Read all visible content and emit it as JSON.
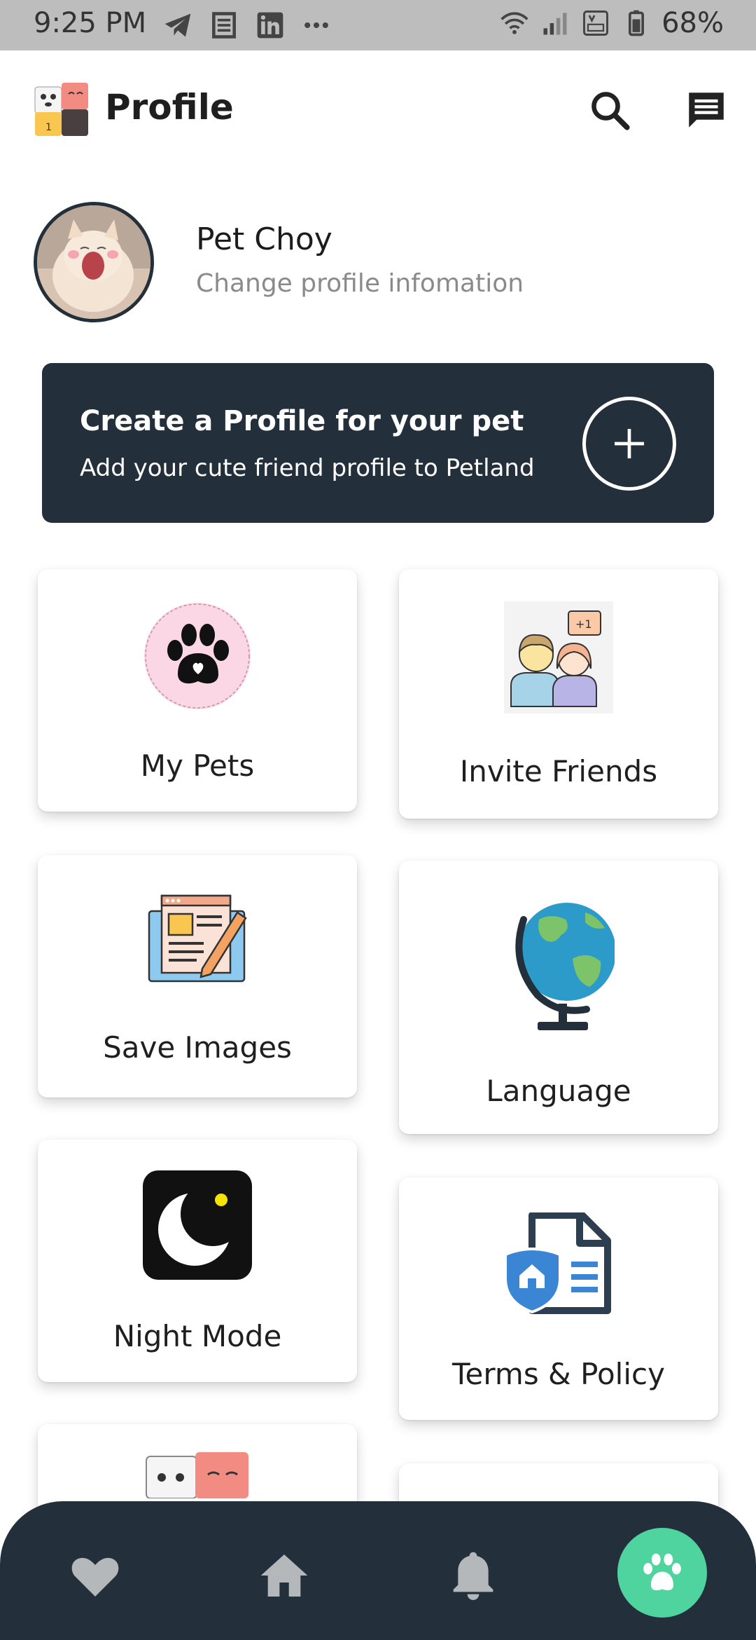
{
  "status_bar": {
    "time": "9:25 PM",
    "battery": "68%",
    "icons": [
      "telegram-icon",
      "news-icon",
      "linkedin-icon",
      "more-dots-icon",
      "wifi-icon",
      "signal-icon",
      "volte-icon",
      "battery-icon"
    ]
  },
  "header": {
    "title": "Profile",
    "icons": [
      "app-logo",
      "search-icon",
      "chat-icon"
    ]
  },
  "profile": {
    "name": "Pet Choy",
    "subtitle": "Change profile infomation"
  },
  "banner": {
    "title": "Create a Profile for your pet",
    "subtitle": "Add your cute friend profile to Petland"
  },
  "menu": {
    "my_pets": "My Pets",
    "invite_friends": "Invite Friends",
    "save_images": "Save Images",
    "language": "Language",
    "night_mode": "Night Mode",
    "terms_policy": "Terms & Policy"
  },
  "bottom_nav": {
    "items": [
      "heart-icon",
      "home-icon",
      "bell-icon",
      "paw-icon"
    ],
    "active": "paw-icon"
  },
  "colors": {
    "banner_bg": "#23303b",
    "nav_bg": "#23303b",
    "active_accent": "#4fd49f",
    "status_bar_bg": "#bdbdbd"
  }
}
